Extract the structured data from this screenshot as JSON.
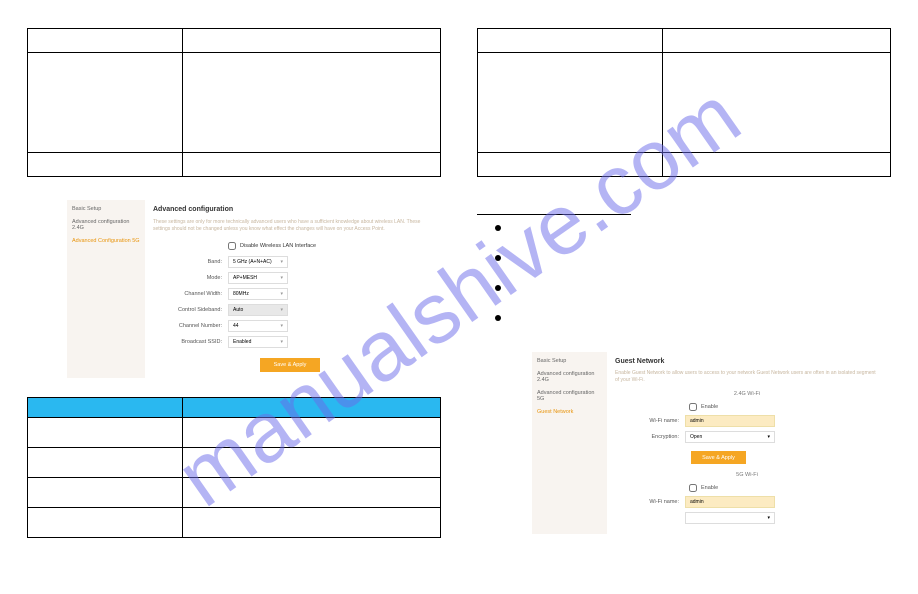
{
  "watermark": "manualshive.com",
  "adv_panel": {
    "nav": {
      "basic": "Basic Setup",
      "adv24": "Advanced configuration 2.4G",
      "adv5": "Advanced Configuration 5G"
    },
    "title": "Advanced configuration",
    "note": "These settings are only for more technically advanced users who have a sufficient knowledge about wireless LAN. These settings should not be changed unless you know what effect the changes will have on your Access Point.",
    "disable_chk": "Disable Wireless LAN Interface",
    "labels": {
      "band": "Band:",
      "mode": "Mode:",
      "chwidth": "Channel Width:",
      "sideband": "Control Sideband:",
      "chnum": "Channel Number:",
      "bssid": "Broadcast SSID:"
    },
    "values": {
      "band": "5 GHz (A+N+AC)",
      "mode": "AP+MESH",
      "chwidth": "80MHz",
      "sideband": "Auto",
      "chnum": "44",
      "bssid": "Enabled"
    },
    "save_btn": "Save & Apply"
  },
  "guest_panel": {
    "nav": {
      "basic": "Basic Setup",
      "adv24": "Advanced configuration 2.4G",
      "adv5": "Advanced configuration 5G",
      "guest": "Guest Network"
    },
    "title": "Guest Network",
    "note": "Enable Guest Network to allow users to access to your network Guest Network users are often in an isolated segment of your Wi-Fi.",
    "sec24": "2.4G Wi-Fi",
    "sec5": "5G Wi-Fi",
    "enable": "Enable",
    "labels": {
      "wifiname": "Wi-Fi name:",
      "encryption": "Encryption:"
    },
    "values": {
      "wifi24": "admin",
      "enc24": "Open",
      "wifi5": "admin"
    },
    "save_btn": "Save & Apply"
  }
}
